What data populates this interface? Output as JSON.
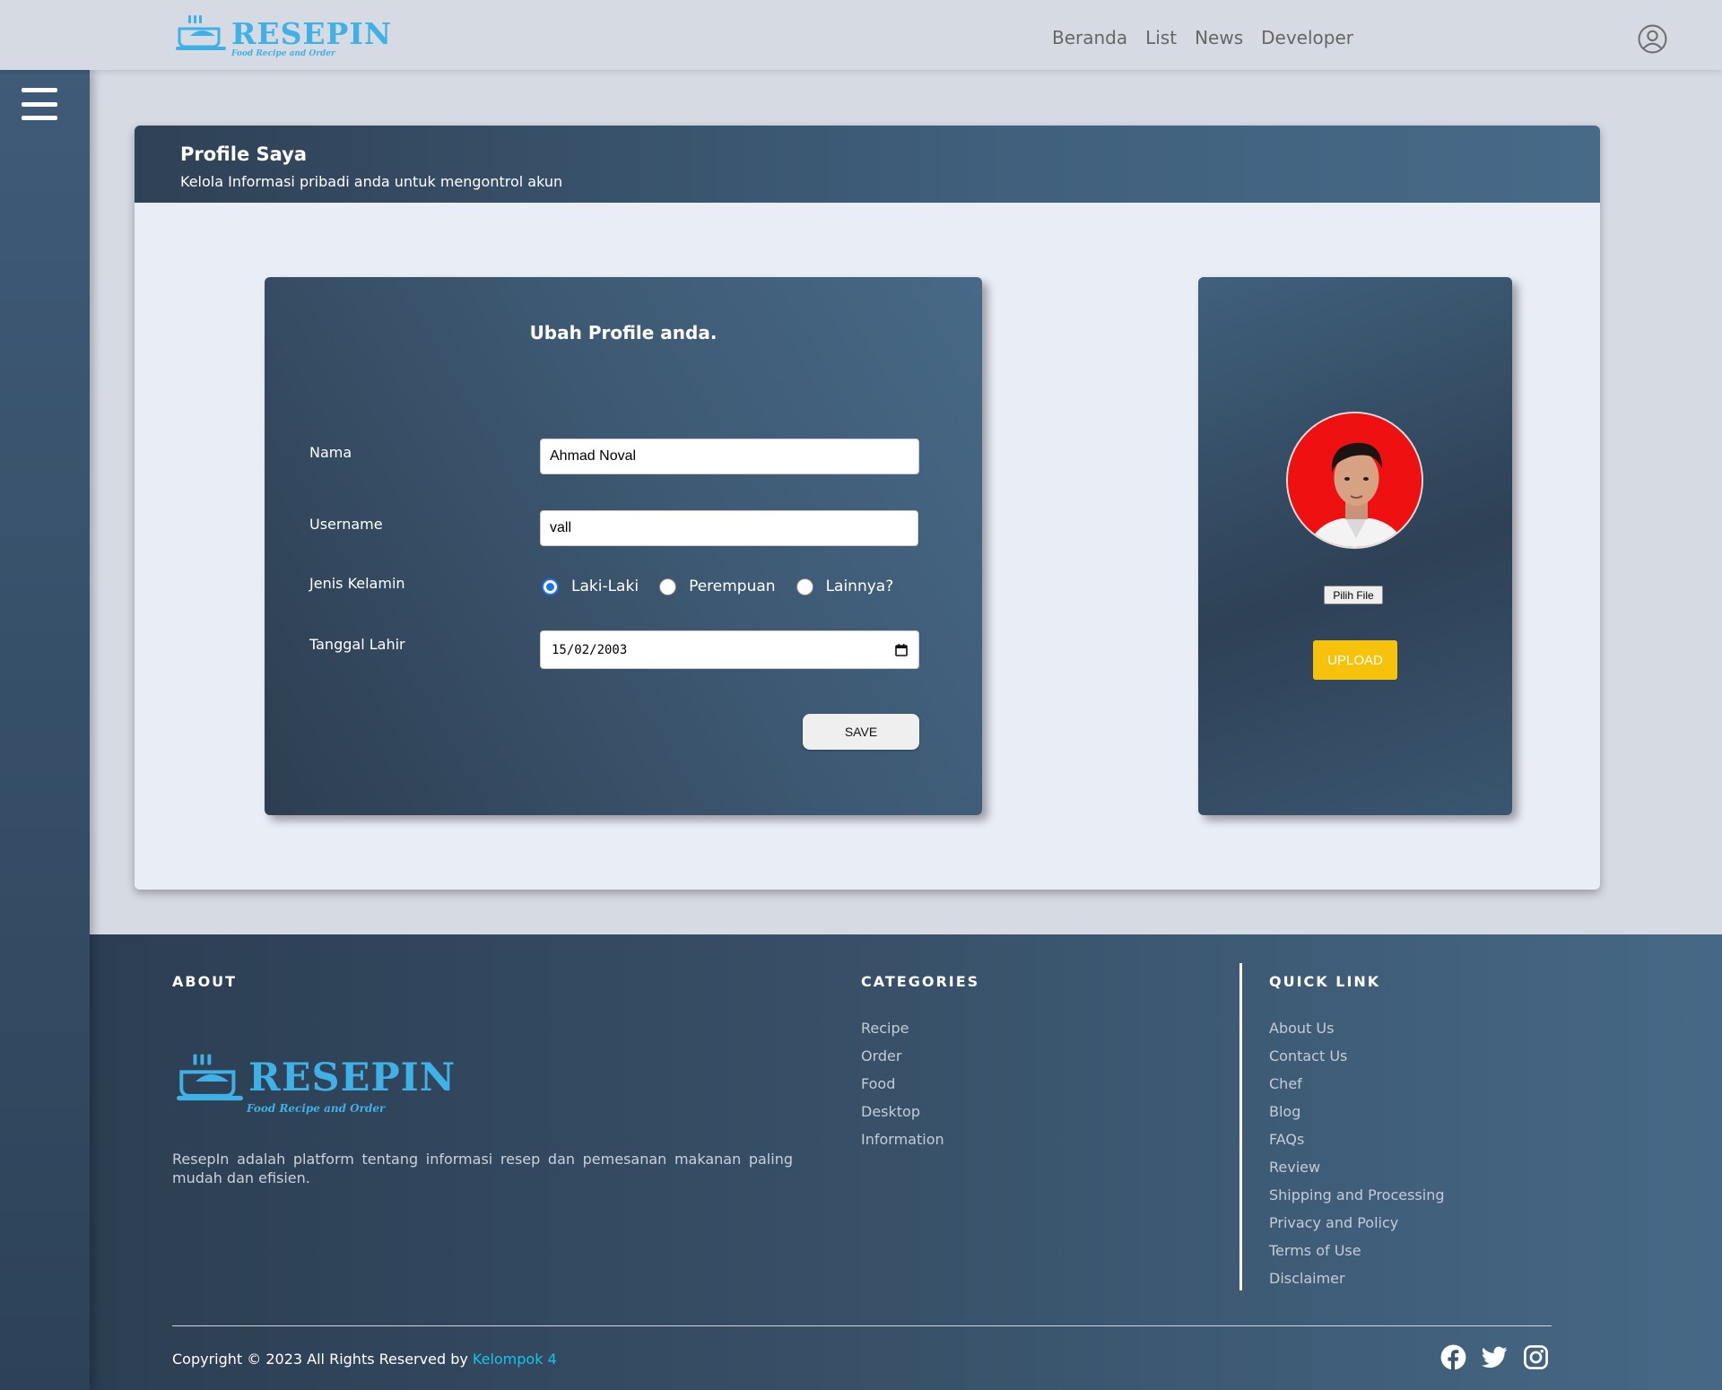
{
  "brand": {
    "name": "RESEPIN",
    "tagline": "Food Recipe and Order"
  },
  "nav": {
    "items": [
      "Beranda",
      "List",
      "News",
      "Developer"
    ]
  },
  "profile": {
    "title": "Profile Saya",
    "subtitle": "Kelola Informasi pribadi anda untuk mengontrol akun",
    "form": {
      "heading": "Ubah Profile anda.",
      "nama_label": "Nama",
      "nama_value": "Ahmad Noval",
      "username_label": "Username",
      "username_value": "vall",
      "gender_label": "Jenis Kelamin",
      "gender_options": [
        "Laki-Laki",
        "Perempuan",
        "Lainnya?"
      ],
      "gender_selected": "Laki-Laki",
      "dob_label": "Tanggal Lahir",
      "dob_value": "15/02/2003",
      "save_label": "SAVE"
    },
    "photo": {
      "file_button": "Pilih File",
      "upload_label": "UPLOAD"
    }
  },
  "footer": {
    "about_heading": "ABOUT",
    "about_text": "ResepIn adalah platform tentang informasi resep dan pemesanan makanan paling mudah dan efisien.",
    "categories_heading": "CATEGORIES",
    "categories": [
      "Recipe",
      "Order",
      "Food",
      "Desktop",
      "Information"
    ],
    "quicklink_heading": "QUICK LINK",
    "quicklinks": [
      "About Us",
      "Contact Us",
      "Chef",
      "Blog",
      "FAQs",
      "Review",
      "Shipping and Processing",
      "Privacy and Policy",
      "Terms of Use",
      "Disclaimer"
    ],
    "copyright": "Copyright © 2023 All Rights Reserved by",
    "copyright_owner": "Kelompok 4",
    "socials": [
      "facebook-icon",
      "twitter-icon",
      "instagram-icon"
    ]
  },
  "colors": {
    "brand": "#3fb1e6",
    "upload": "#f6c20b",
    "accent_link": "#17c3e7",
    "radio": "#1a73e8"
  }
}
